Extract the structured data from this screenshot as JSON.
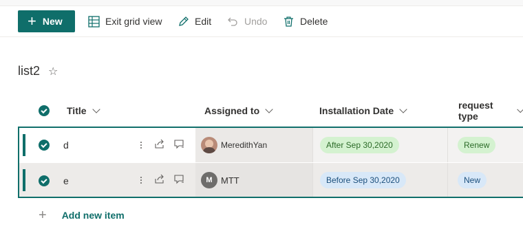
{
  "toolbar": {
    "new_label": "New",
    "exit_grid_label": "Exit grid view",
    "edit_label": "Edit",
    "undo_label": "Undo",
    "delete_label": "Delete"
  },
  "list": {
    "title": "list2"
  },
  "columns": {
    "title": "Title",
    "assigned_to": "Assigned to",
    "installation_date": "Installation Date",
    "request_type": "request type"
  },
  "rows": [
    {
      "title": "d",
      "assigned_to": "MeredithYan",
      "installation_date": "After Sep 30,2020",
      "request_type": "Renew"
    },
    {
      "title": "e",
      "assigned_to": "MTT",
      "assigned_initial": "M",
      "installation_date": "Before Sep 30,2020",
      "request_type": "New"
    }
  ],
  "add_item": {
    "label": "Add new item"
  },
  "colors": {
    "accent": "#0f6e6a",
    "pill_green": "#d4f2d0",
    "pill_blue": "#d8e8f8"
  },
  "icons": {
    "new": "plus-icon",
    "exit_grid": "grid-icon",
    "edit": "pencil-icon",
    "undo": "undo-icon",
    "delete": "trash-icon",
    "favorite": "star-icon",
    "row_more": "more-vertical-icon",
    "row_share": "share-icon",
    "row_comment": "comment-icon"
  }
}
